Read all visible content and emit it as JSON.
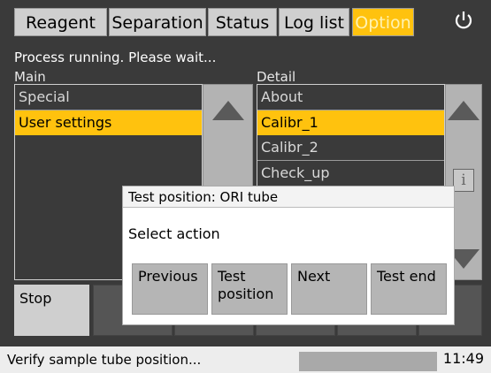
{
  "tabs": [
    {
      "label": "Reagent",
      "active": false
    },
    {
      "label": "Separation",
      "active": false
    },
    {
      "label": "Status",
      "active": false
    },
    {
      "label": "Log list",
      "active": false
    },
    {
      "label": "Option",
      "active": true
    }
  ],
  "icons": {
    "power": "power-icon",
    "info": "info-icon",
    "scroll_up": "arrow-up-icon",
    "scroll_down": "arrow-down-icon"
  },
  "status_line": "Process running. Please wait...",
  "main": {
    "label": "Main",
    "items": [
      {
        "label": "Special",
        "selected": false
      },
      {
        "label": "User settings",
        "selected": true
      }
    ]
  },
  "detail": {
    "label": "Detail",
    "items": [
      {
        "label": "About",
        "selected": false
      },
      {
        "label": "Calibr_1",
        "selected": true
      },
      {
        "label": "Calibr_2",
        "selected": false
      },
      {
        "label": "Check_up",
        "selected": false
      }
    ]
  },
  "actions": {
    "stop": "Stop"
  },
  "dialog": {
    "title": "Test position: ORI tube",
    "message": "Select action",
    "buttons": [
      "Previous",
      "Test position",
      "Next",
      "Test end"
    ]
  },
  "status_bar": {
    "message": "Verify sample tube position...",
    "time": "11:49"
  },
  "colors": {
    "accent": "#ffc20e",
    "background": "#3a3a3a",
    "panel": "#cfcfcf"
  }
}
